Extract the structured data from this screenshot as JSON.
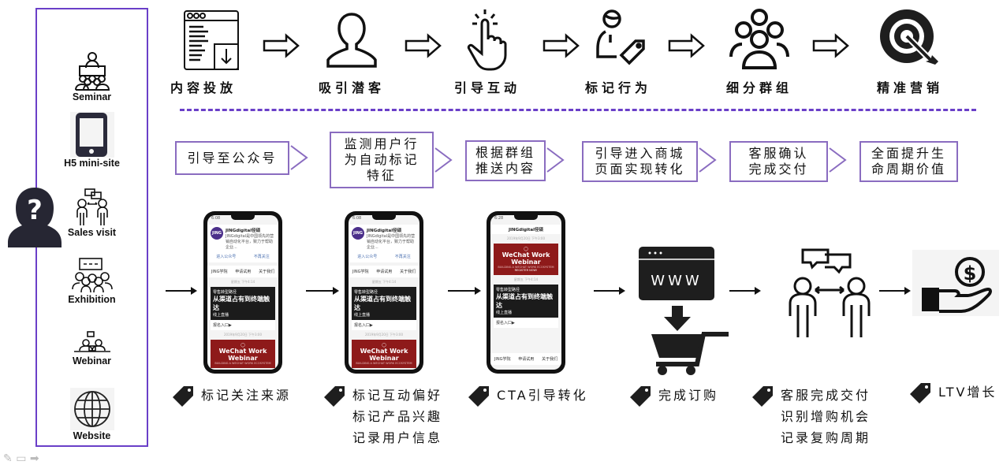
{
  "channels": {
    "unknown_person_icon": "question-person-icon",
    "items": [
      {
        "label": "Seminar",
        "icon": "seminar-icon"
      },
      {
        "label": "H5 mini-site",
        "icon": "mobile-phone-icon"
      },
      {
        "label": "Sales visit",
        "icon": "sales-visit-icon"
      },
      {
        "label": "Exhibition",
        "icon": "exhibition-icon"
      },
      {
        "label": "Webinar",
        "icon": "webinar-icon"
      },
      {
        "label": "Website",
        "icon": "globe-icon"
      }
    ]
  },
  "steps": [
    {
      "label": "内容投放",
      "icon": "content-browser-icon"
    },
    {
      "label": "吸引潜客",
      "icon": "user-outline-icon"
    },
    {
      "label": "引导互动",
      "icon": "tap-hand-icon"
    },
    {
      "label": "标记行为",
      "icon": "user-tag-icon"
    },
    {
      "label": "细分群组",
      "icon": "group-icon"
    },
    {
      "label": "精准营销",
      "icon": "target-icon"
    }
  ],
  "process": [
    {
      "lines": [
        "引导至公众号"
      ]
    },
    {
      "lines": [
        "监测用户行",
        "为自动标记",
        "特征"
      ]
    },
    {
      "lines": [
        "根据群组",
        "推送内容"
      ]
    },
    {
      "lines": [
        "引导进入商城",
        "页面实现转化"
      ]
    },
    {
      "lines": [
        "客服确认",
        "完成交付"
      ]
    },
    {
      "lines": [
        "全面提升生",
        "命周期价值"
      ]
    }
  ],
  "phones": {
    "time": "6:08",
    "time3": "6:28",
    "account_name": "JINGdigital径硕",
    "logo": "JING",
    "desc": "JINGdigital是中国领先的营销自动化平台，致力于帮助企业...",
    "link_enter": "进入公众号",
    "link_unfollow": "不再关注",
    "menu": [
      "JING学院",
      "申请试用",
      "关于我们"
    ],
    "ts1": "星期五 下午4:14",
    "ts2": "2019年9月20日 下午3:00",
    "card_title": "从渠道占有到终端触达",
    "card_sub": "零售转型路径",
    "card_btn": "线上直播",
    "register_entry": "报名入口▶",
    "webinar_title": "WeChat Work Webinar",
    "webinar_sub": "BUILDING A WECHAT WORK ECOSYSTEM",
    "register_now": "REGISTER NOW!"
  },
  "stage_icons": {
    "website": "www-browser-icon",
    "cart": "shopping-cart-icon",
    "service": "customer-service-conversation-icon",
    "ltv": "money-hand-icon",
    "www_text": "WWW"
  },
  "tags": [
    {
      "lines": [
        "标记关注来源"
      ]
    },
    {
      "lines": [
        "标记互动偏好",
        "标记产品兴趣",
        "记录用户信息"
      ]
    },
    {
      "lines": [
        "CTA引导转化"
      ]
    },
    {
      "lines": [
        "完成订购"
      ]
    },
    {
      "lines": [
        "客服完成交付",
        "识别增购机会",
        "记录复购周期"
      ]
    },
    {
      "lines": [
        "LTV增长"
      ]
    }
  ],
  "colors": {
    "accent": "#6a3fc8",
    "box_border": "#8a6cc0",
    "dark": "#1e1e1e",
    "wine": "#8e1a1a"
  }
}
